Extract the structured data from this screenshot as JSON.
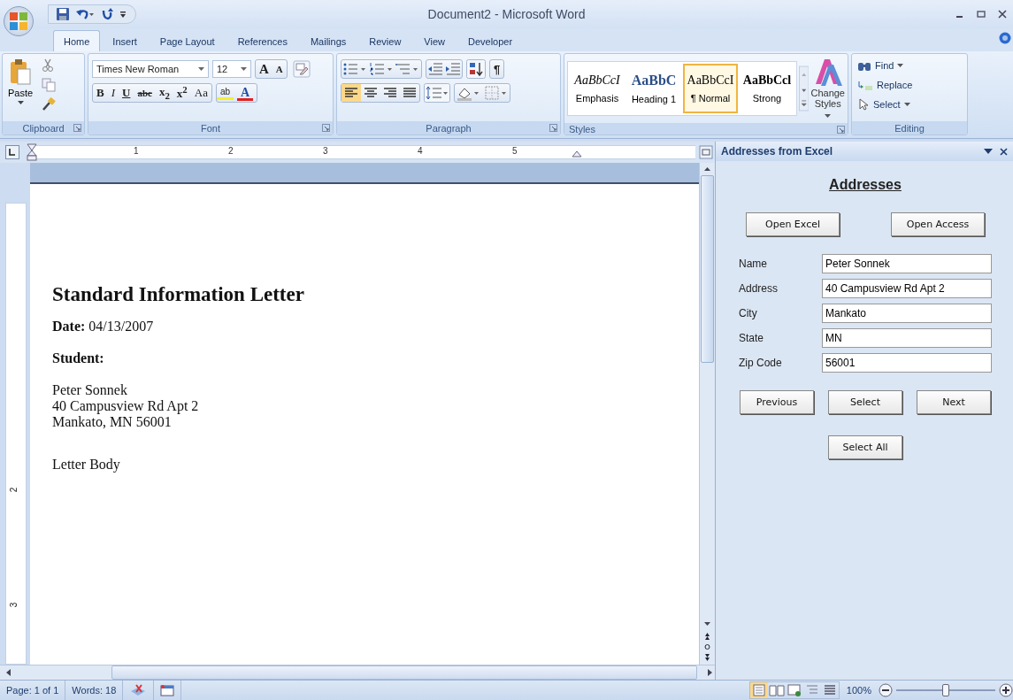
{
  "window": {
    "title": "Document2 - Microsoft Word"
  },
  "tabs": [
    {
      "label": "Home",
      "selected": true
    },
    {
      "label": "Insert",
      "selected": false
    },
    {
      "label": "Page Layout",
      "selected": false
    },
    {
      "label": "References",
      "selected": false
    },
    {
      "label": "Mailings",
      "selected": false
    },
    {
      "label": "Review",
      "selected": false
    },
    {
      "label": "View",
      "selected": false
    },
    {
      "label": "Developer",
      "selected": false
    }
  ],
  "ribbon": {
    "clipboard": {
      "label": "Clipboard",
      "paste": "Paste"
    },
    "font": {
      "label": "Font",
      "font_name": "Times New Roman",
      "font_size": "12",
      "size_buttons": [
        "A",
        "A"
      ],
      "format_buttons": [
        {
          "kind": "bold",
          "label": "B"
        },
        {
          "kind": "italic",
          "label": "I"
        },
        {
          "kind": "underline",
          "label": "U"
        },
        {
          "kind": "strike",
          "label": "abc"
        },
        {
          "kind": "plain",
          "label": "x$_{2}$"
        },
        {
          "kind": "plain",
          "label": "x$^{2}$"
        },
        {
          "kind": "case",
          "label": "Aa"
        },
        {
          "kind": "highlight",
          "label": "ab"
        },
        {
          "kind": "color",
          "label": "A"
        }
      ]
    },
    "paragraph": {
      "label": "Paragraph",
      "marks_button": "¶"
    },
    "styles": {
      "label": "Styles",
      "items": [
        {
          "preview": "AaBbCcI",
          "name": "Emphasis",
          "kind": "italic",
          "selected": false
        },
        {
          "preview": "AaBbC",
          "name": "Heading 1",
          "kind": "heading",
          "selected": false
        },
        {
          "preview": "AaBbCcI",
          "name": "¶ Normal",
          "kind": "normal",
          "selected": true
        },
        {
          "preview": "AaBbCcl",
          "name": "Strong",
          "kind": "strong",
          "selected": false
        }
      ],
      "change_styles": "Change Styles"
    },
    "editing": {
      "label": "Editing",
      "items": [
        {
          "kind": "find",
          "label": "Find"
        },
        {
          "kind": "replace",
          "label": "Replace"
        },
        {
          "kind": "select",
          "label": "Select"
        }
      ]
    }
  },
  "ruler": {
    "numbers": [
      "1",
      "2",
      "3",
      "4",
      "5"
    ],
    "vertical_numbers": [
      "2",
      "3"
    ]
  },
  "document": {
    "heading": "Standard Information Letter",
    "date": "**Date:** 04/13/2007",
    "student_label": "Student:",
    "address_lines": [
      "Peter Sonnek",
      "40 Campusview Rd Apt 2",
      "Mankato, MN 56001"
    ],
    "body": "Letter Body"
  },
  "task_pane": {
    "title": "Addresses from Excel",
    "heading": "Addresses",
    "source_buttons": [
      "Open Excel",
      "Open Access"
    ],
    "fields": [
      {
        "label": "Name",
        "value": "Peter Sonnek"
      },
      {
        "label": "Address",
        "value": "40 Campusview Rd Apt 2"
      },
      {
        "label": "City",
        "value": "Mankato"
      },
      {
        "label": "State",
        "value": "MN"
      },
      {
        "label": "Zip Code",
        "value": "56001"
      }
    ],
    "nav_buttons": [
      "Previous",
      "Select",
      "Next"
    ],
    "select_all": "Select All"
  },
  "status_bar": {
    "page": "Page: 1 of 1",
    "words": "Words: 18",
    "views": [
      {
        "kind": "print",
        "selected": true
      },
      {
        "kind": "reading",
        "selected": false
      },
      {
        "kind": "web",
        "selected": false
      },
      {
        "kind": "outline",
        "selected": false
      },
      {
        "kind": "draft",
        "selected": false
      }
    ],
    "zoom": "100%",
    "zoom_level": {
      "level": 0.5
    }
  }
}
